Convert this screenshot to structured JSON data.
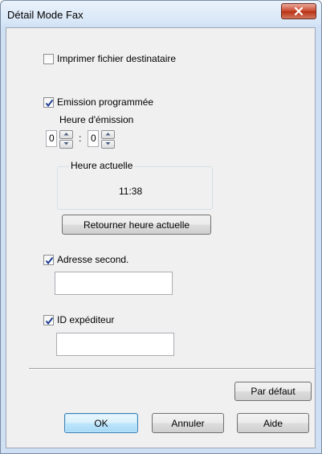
{
  "window": {
    "title": "Détail Mode Fax",
    "close_icon": "close-icon"
  },
  "options": {
    "print_recipient_file": {
      "label": "Imprimer fichier destinataire",
      "checked": false
    },
    "scheduled_send": {
      "label": "Emission programmée",
      "checked": true
    },
    "second_address": {
      "label": "Adresse second.",
      "checked": true,
      "value": ""
    },
    "sender_id": {
      "label": "ID expéditeur",
      "checked": true,
      "value": ""
    }
  },
  "send_time": {
    "label": "Heure d'émission",
    "hour": "0",
    "separator": ":",
    "minute": "0"
  },
  "current_time": {
    "group_label": "Heure actuelle",
    "value": "11:38",
    "reset_button": "Retourner heure actuelle"
  },
  "buttons": {
    "default": "Par défaut",
    "ok": "OK",
    "cancel": "Annuler",
    "help": "Aide"
  },
  "colors": {
    "close_button": "#c9462c",
    "default_button_border": "#3c7fb1"
  }
}
